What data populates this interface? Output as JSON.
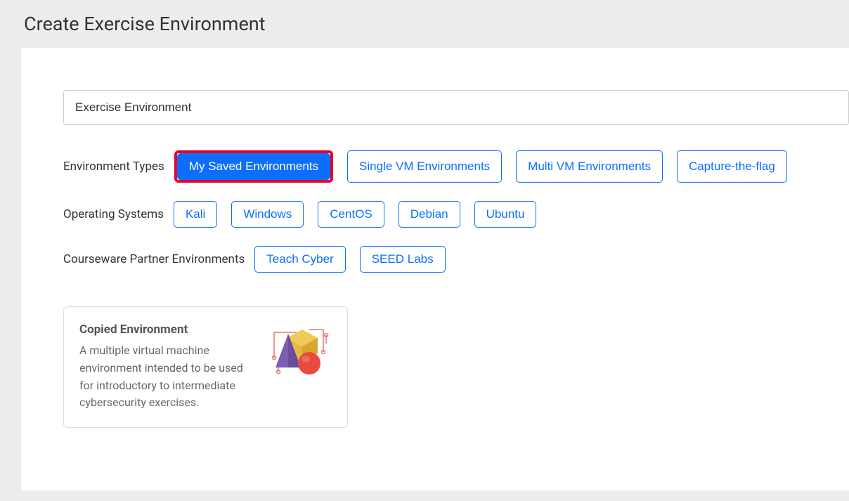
{
  "page": {
    "title": "Create Exercise Environment"
  },
  "input": {
    "value": "Exercise Environment"
  },
  "filters": {
    "environment_types": {
      "label": "Environment Types",
      "buttons": [
        {
          "label": "My Saved Environments",
          "active": true
        },
        {
          "label": "Single VM Environments",
          "active": false
        },
        {
          "label": "Multi VM Environments",
          "active": false
        },
        {
          "label": "Capture-the-flag",
          "active": false
        }
      ]
    },
    "operating_systems": {
      "label": "Operating Systems",
      "buttons": [
        {
          "label": "Kali"
        },
        {
          "label": "Windows"
        },
        {
          "label": "CentOS"
        },
        {
          "label": "Debian"
        },
        {
          "label": "Ubuntu"
        }
      ]
    },
    "courseware": {
      "label": "Courseware Partner Environments",
      "buttons": [
        {
          "label": "Teach Cyber"
        },
        {
          "label": "SEED Labs"
        }
      ]
    }
  },
  "cards": [
    {
      "title": "Copied Environment",
      "description": "A multiple virtual machine environment intended to be used for introductory to intermediate cybersecurity exercises."
    }
  ]
}
